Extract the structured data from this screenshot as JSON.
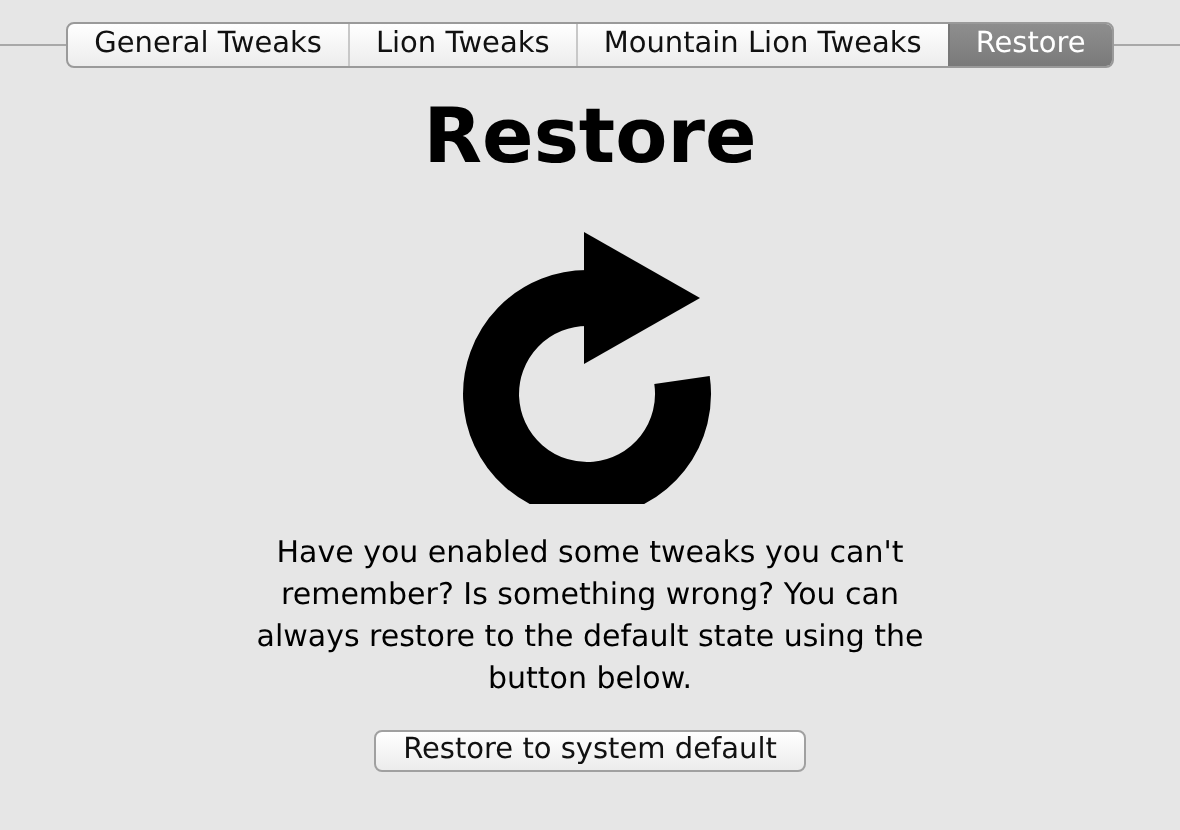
{
  "tabs": [
    {
      "label": "General Tweaks",
      "selected": false
    },
    {
      "label": "Lion Tweaks",
      "selected": false
    },
    {
      "label": "Mountain Lion Tweaks",
      "selected": false
    },
    {
      "label": "Restore",
      "selected": true
    }
  ],
  "heading": "Restore",
  "description": "Have you enabled some tweaks you can't remember? Is something wrong? You can always restore to the default state using the button below.",
  "button": "Restore to system default"
}
